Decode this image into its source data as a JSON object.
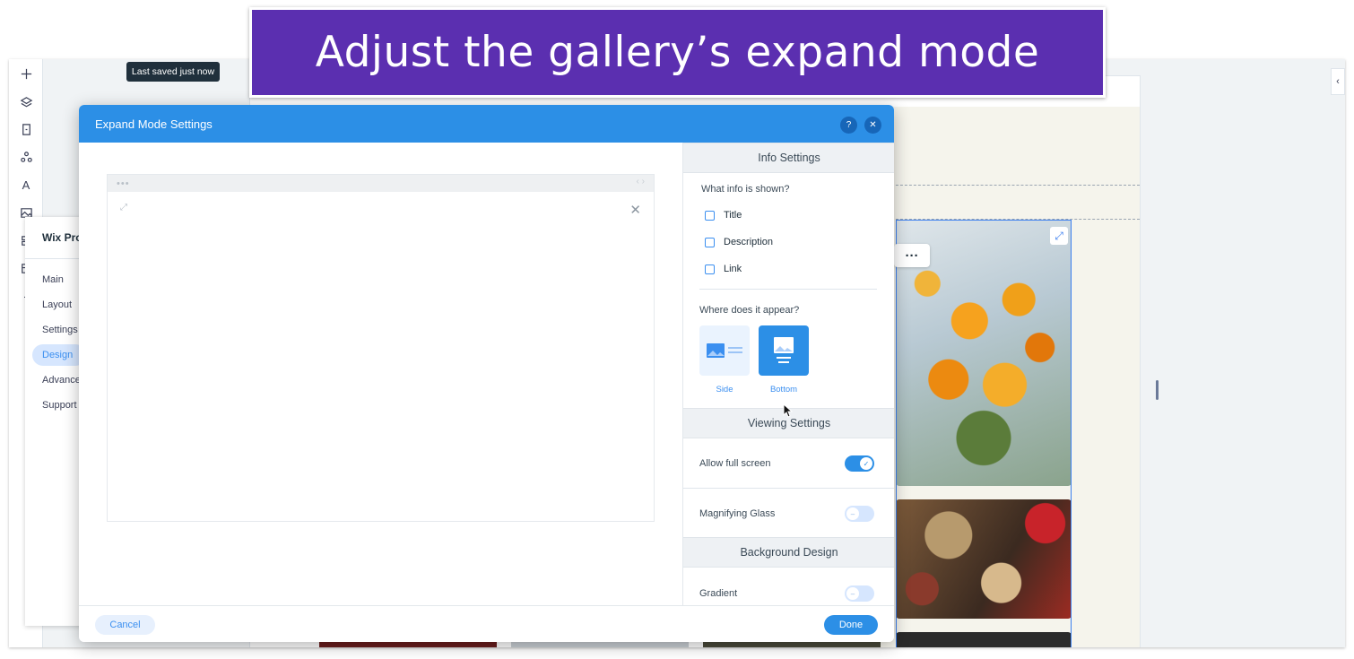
{
  "banner": {
    "text": "Adjust the gallery’s expand mode"
  },
  "editor": {
    "tooltip": "Last saved just now",
    "toolbar": {
      "text_icon_label": "A",
      "code_icon_label": "{"
    },
    "collapse_icon": "‹"
  },
  "wix_panel": {
    "title": "Wix Pro",
    "items": [
      "Main",
      "Layout",
      "Settings",
      "Design",
      "Advance",
      "Support"
    ],
    "selected": "Design"
  },
  "gallery": {
    "more_label": "···",
    "expand_icon": "⤢"
  },
  "modal": {
    "title": "Expand Mode Settings",
    "help_label": "?",
    "close_label": "✕",
    "preview": {
      "dots": "•••",
      "arrows": "‹ ›",
      "expand_icon": "⤢",
      "close_icon": "✕"
    },
    "info_settings": {
      "header": "Info Settings",
      "question": "What info is shown?",
      "options": [
        {
          "label": "Title",
          "checked": false
        },
        {
          "label": "Description",
          "checked": false
        },
        {
          "label": "Link",
          "checked": false
        }
      ],
      "position_question": "Where does it appear?",
      "positions": [
        {
          "label": "Side",
          "selected": false
        },
        {
          "label": "Bottom",
          "selected": true
        }
      ]
    },
    "viewing_settings": {
      "header": "Viewing Settings",
      "allow_full_screen": {
        "label": "Allow full screen",
        "on": true
      },
      "magnifying_glass": {
        "label": "Magnifying Glass",
        "on": false
      }
    },
    "background_design": {
      "header": "Background Design",
      "gradient": {
        "label": "Gradient",
        "on": false
      }
    },
    "footer": {
      "cancel": "Cancel",
      "done": "Done"
    }
  },
  "colors": {
    "accent": "#2c8fe6",
    "banner": "#5b2fb0",
    "toggle_off": "#d6e6fe"
  }
}
